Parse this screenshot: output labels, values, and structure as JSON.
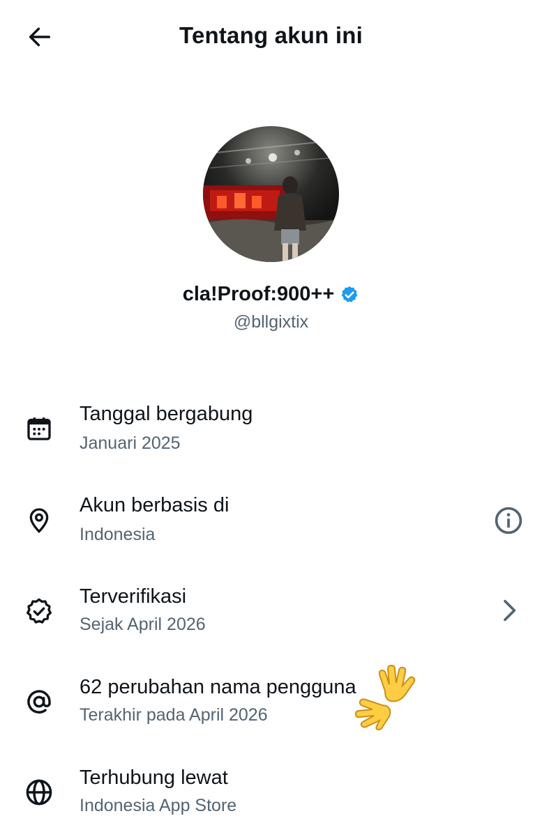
{
  "header": {
    "title": "Tentang akun ini",
    "back_icon": "arrow-left-icon"
  },
  "profile": {
    "display_name": "cla!Proof:900++",
    "handle": "@bllgixtix",
    "verified_icon": "verified-badge-icon",
    "verified_color": "#1d9bf0"
  },
  "rows": [
    {
      "icon": "calendar-icon",
      "title": "Tanggal bergabung",
      "subtitle": "Januari 2025"
    },
    {
      "icon": "location-pin-icon",
      "title": "Akun berbasis di",
      "subtitle": "Indonesia",
      "trailing_icon": "info-icon"
    },
    {
      "icon": "verified-check-icon",
      "title": "Terverifikasi",
      "subtitle": "Sejak April 2026",
      "trailing_icon": "chevron-right-icon"
    },
    {
      "icon": "at-sign-icon",
      "title": "62 perubahan nama pengguna",
      "subtitle": "Terakhir pada April 2026"
    },
    {
      "icon": "globe-icon",
      "title": "Terhubung lewat",
      "subtitle": "Indonesia App Store"
    }
  ],
  "colors": {
    "text_primary": "#0f1419",
    "text_secondary": "#536471",
    "accent": "#1d9bf0"
  }
}
